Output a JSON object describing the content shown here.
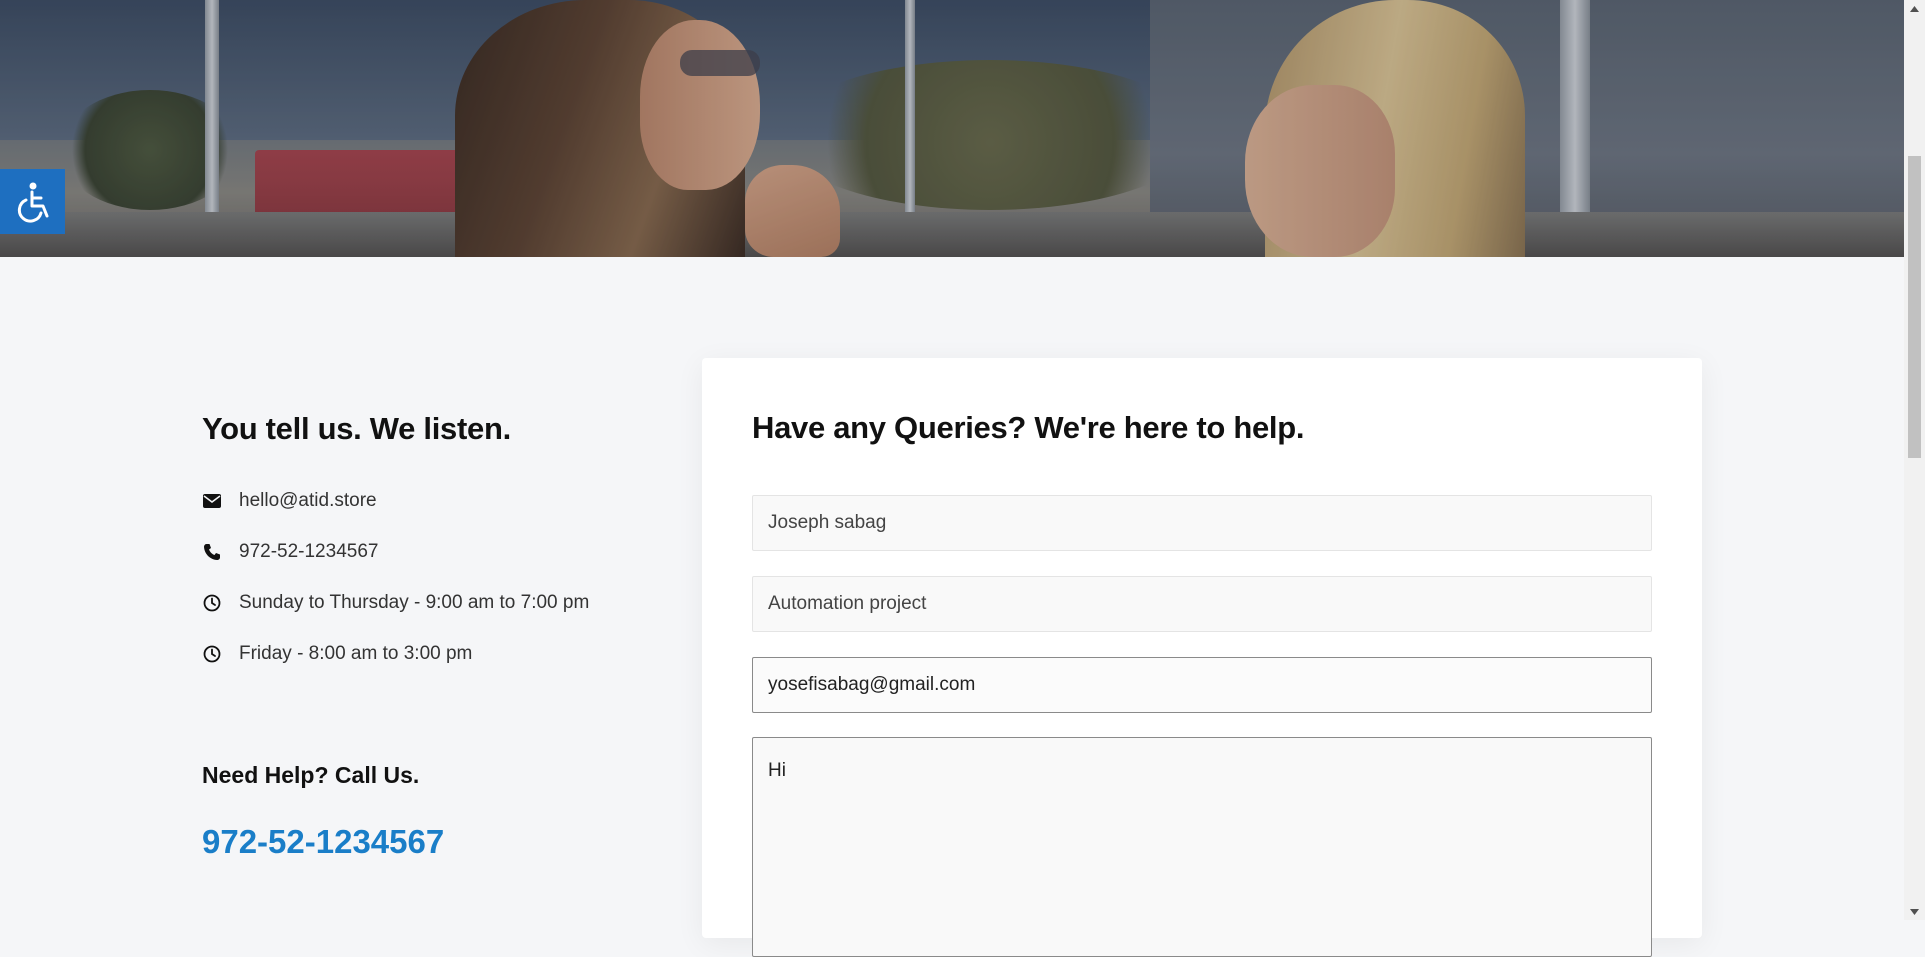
{
  "accessibility": {
    "icon": "wheelchair-icon",
    "color": "#1e6fc0"
  },
  "info": {
    "heading": "You tell us. We listen.",
    "contacts": [
      {
        "icon": "envelope-icon",
        "text": "hello@atid.store"
      },
      {
        "icon": "phone-icon",
        "text": "972-52-1234567"
      },
      {
        "icon": "clock-icon",
        "text": "Sunday to Thursday - 9:00 am to 7:00 pm"
      },
      {
        "icon": "clock-icon",
        "text": "Friday - 8:00 am to 3:00 pm"
      }
    ],
    "help_title": "Need Help? Call Us.",
    "help_phone": "972-52-1234567",
    "help_phone_color": "#1a7ec8"
  },
  "form": {
    "heading": "Have any Queries? We're here to help.",
    "name_value": "Joseph sabag",
    "subject_value": "Automation project",
    "email_value": "yosefisabag@gmail.com",
    "message_value": "Hi"
  }
}
